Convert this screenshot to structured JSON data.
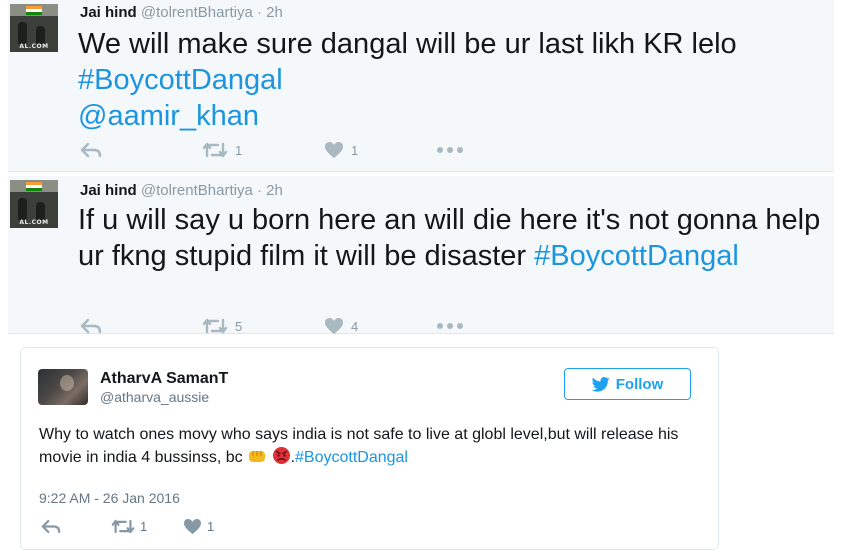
{
  "tweets": [
    {
      "name": "Jai hind",
      "handle": "@tolrentBhartiya",
      "separator": "·",
      "time": "2h",
      "text_main": "We will make sure dangal will be ur last likh KR lelo ",
      "hashtag": "#BoycottDangal",
      "mention": "@aamir_khan",
      "retweets": "1",
      "likes": "1",
      "avatar_caption": "AL.COM"
    },
    {
      "name": "Jai hind",
      "handle": "@tolrentBhartiya",
      "separator": "·",
      "time": "2h",
      "text_main": "If u will say u born here an will die here it's not gonna help ur fkng stupid film it will be disaster ",
      "hashtag": "#BoycottDangal",
      "retweets": "5",
      "likes": "4",
      "avatar_caption": "AL.COM"
    }
  ],
  "embedded_tweet": {
    "name": "AtharvA SamanT",
    "handle": "@atharva_aussie",
    "follow_label": "Follow",
    "text_main": "Why to watch ones movy who says india is not safe to live at globl level,but will release his movie in india 4 bussinss, bc",
    "hashtag_prefix": ".",
    "hashtag": "#BoycottDangal",
    "timestamp": "9:22 AM - 26 Jan 2016",
    "retweets": "1",
    "likes": "1"
  },
  "colors": {
    "link": "#1b95e0",
    "follow_blue": "#1da1f2",
    "muted": "#8899a6",
    "card_bg": "#f5f8fa"
  },
  "icons": [
    "reply-icon",
    "retweet-icon",
    "heart-icon",
    "more-icon",
    "twitter-bird-icon",
    "fist-emoji-icon",
    "angry-face-emoji-icon"
  ]
}
